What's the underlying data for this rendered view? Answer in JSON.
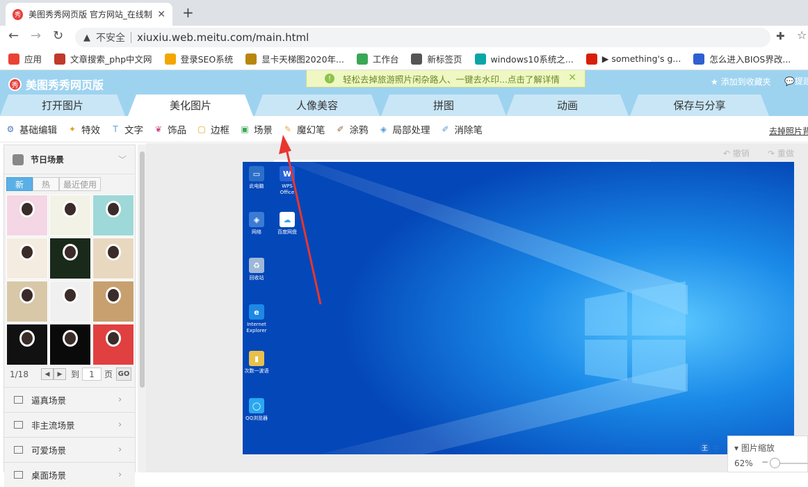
{
  "browser": {
    "tab_title": "美图秀秀网页版 官方网站_在线制",
    "tab_favicon": "秀",
    "tab_close": "✕",
    "new_tab": "+",
    "security_text": "不安全",
    "url": "xiuxiu.web.meitu.com/main.html",
    "nav": {
      "back": "←",
      "forward": "→",
      "reload": "↻"
    }
  },
  "bookmarks": [
    {
      "label": "应用",
      "icon": "apps-grid-icon",
      "color": "#e94235"
    },
    {
      "label": "文章搜索_php中文网",
      "icon": "php-icon",
      "color": "#c0392b"
    },
    {
      "label": "登录SEO系统",
      "icon": "windows-logo-icon",
      "color": "#f2a600"
    },
    {
      "label": "显卡天梯图2020年...",
      "icon": "document-icon",
      "color": "#b8860b"
    },
    {
      "label": "工作台",
      "icon": "windows-logo-icon",
      "color": "#3aa757"
    },
    {
      "label": "新标签页",
      "icon": "globe-icon",
      "color": "#555555"
    },
    {
      "label": "windows10系统之...",
      "icon": "u-logo-icon",
      "color": "#0aa5a5"
    },
    {
      "label": "▶ something's g...",
      "icon": "netease-icon",
      "color": "#d81e06"
    },
    {
      "label": "怎么进入BIOS界改...",
      "icon": "baidu-paw-icon",
      "color": "#2f5fd0"
    }
  ],
  "app": {
    "logo_text": "美图秀秀网页版",
    "promo_text": "轻松去掉旅游照片闲杂路人、一键去水印...点击了解详情",
    "favorite_text": "添加到收藏夹",
    "feedback_text": "提建",
    "main_tabs": [
      "打开图片",
      "美化图片",
      "人像美容",
      "拼图",
      "动画",
      "保存与分享"
    ],
    "active_main_tab": "美化图片",
    "sub_tools": [
      {
        "label": "基础编辑",
        "icon": "sliders-icon"
      },
      {
        "label": "特效",
        "icon": "magic-wand-icon"
      },
      {
        "label": "文字",
        "icon": "text-t-icon"
      },
      {
        "label": "饰品",
        "icon": "accessory-icon"
      },
      {
        "label": "边框",
        "icon": "frame-icon"
      },
      {
        "label": "场景",
        "icon": "scene-image-icon"
      },
      {
        "label": "魔幻笔",
        "icon": "magic-pen-icon"
      },
      {
        "label": "涂鸦",
        "icon": "brush-icon"
      },
      {
        "label": "局部处理",
        "icon": "local-edit-icon"
      },
      {
        "label": "消除笔",
        "icon": "eraser-pen-icon"
      }
    ],
    "remove_bg_link": "去掉照片背",
    "undo": "撤销",
    "redo": "重做"
  },
  "left_panel": {
    "title": "节日场景",
    "subtabs": [
      "新",
      "热",
      "最近使用"
    ],
    "active_subtab": "新",
    "page_indicator": "1/18",
    "goto_label": "到",
    "page_value": "1",
    "page_unit": "页",
    "go_label": "GO",
    "categories": [
      "逼真场景",
      "非主流场景",
      "可爱场景",
      "桌面场景"
    ]
  },
  "desktop": {
    "icons": [
      {
        "label": "此电脑",
        "color": "#2b6fc9"
      },
      {
        "label": "WPS Office",
        "color": "#2a63d8"
      },
      {
        "label": "网络",
        "color": "#3a7bd5"
      },
      {
        "label": "百度网盘",
        "color": "#ffffff"
      },
      {
        "label": "回收站",
        "color": "#9fb8d8"
      },
      {
        "label": "Internet Explorer",
        "color": "#1e88e5"
      },
      {
        "label": "次数一波语",
        "color": "#e8c04a"
      },
      {
        "label": "QQ浏览器",
        "color": "#29a8f0"
      }
    ],
    "ime_glyph": "王",
    "ime_text": "中"
  },
  "zoom": {
    "label": "图片缩放",
    "value": "62%",
    "level": 0.0
  }
}
